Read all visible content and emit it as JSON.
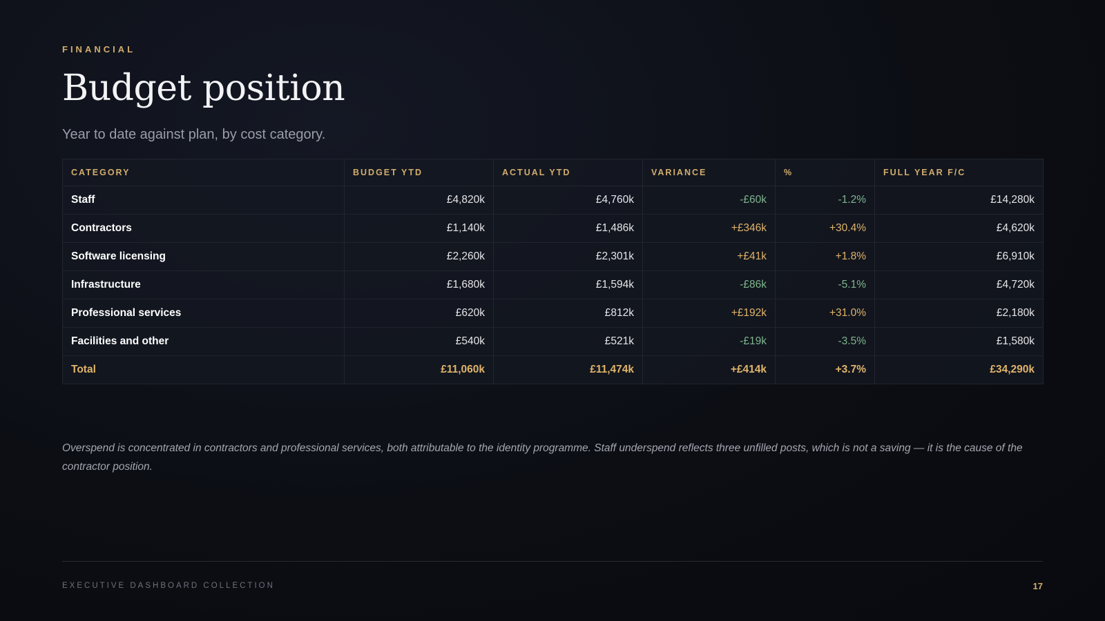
{
  "header": {
    "eyebrow": "FINANCIAL",
    "title": "Budget position",
    "subtitle": "Year to date against plan, by cost category."
  },
  "table": {
    "columns": [
      "CATEGORY",
      "BUDGET YTD",
      "ACTUAL YTD",
      "VARIANCE",
      "%",
      "FULL YEAR F/C"
    ],
    "rows": [
      {
        "category": "Staff",
        "budget": "£4,820k",
        "actual": "£4,760k",
        "variance": "-£60k",
        "pct": "-1.2%",
        "forecast": "£14,280k",
        "status": "under"
      },
      {
        "category": "Contractors",
        "budget": "£1,140k",
        "actual": "£1,486k",
        "variance": "+£346k",
        "pct": "+30.4%",
        "forecast": "£4,620k",
        "status": "over"
      },
      {
        "category": "Software licensing",
        "budget": "£2,260k",
        "actual": "£2,301k",
        "variance": "+£41k",
        "pct": "+1.8%",
        "forecast": "£6,910k",
        "status": "over"
      },
      {
        "category": "Infrastructure",
        "budget": "£1,680k",
        "actual": "£1,594k",
        "variance": "-£86k",
        "pct": "-5.1%",
        "forecast": "£4,720k",
        "status": "under"
      },
      {
        "category": "Professional services",
        "budget": "£620k",
        "actual": "£812k",
        "variance": "+£192k",
        "pct": "+31.0%",
        "forecast": "£2,180k",
        "status": "over"
      },
      {
        "category": "Facilities and other",
        "budget": "£540k",
        "actual": "£521k",
        "variance": "-£19k",
        "pct": "-3.5%",
        "forecast": "£1,580k",
        "status": "under"
      }
    ],
    "total": {
      "category": "Total",
      "budget": "£11,060k",
      "actual": "£11,474k",
      "variance": "+£414k",
      "pct": "+3.7%",
      "forecast": "£34,290k"
    }
  },
  "note": "Overspend is concentrated in contractors and professional services, both attributable to the identity programme. Staff underspend reflects three unfilled posts, which is not a saving — it is the cause of the contractor position.",
  "footer": {
    "collection": "EXECUTIVE DASHBOARD COLLECTION",
    "page_number": "17"
  },
  "colors": {
    "accent": "#d2ad6e",
    "under_budget": "#7fb68e",
    "over_budget": "#e0b46a",
    "background": "#0c0e14"
  }
}
